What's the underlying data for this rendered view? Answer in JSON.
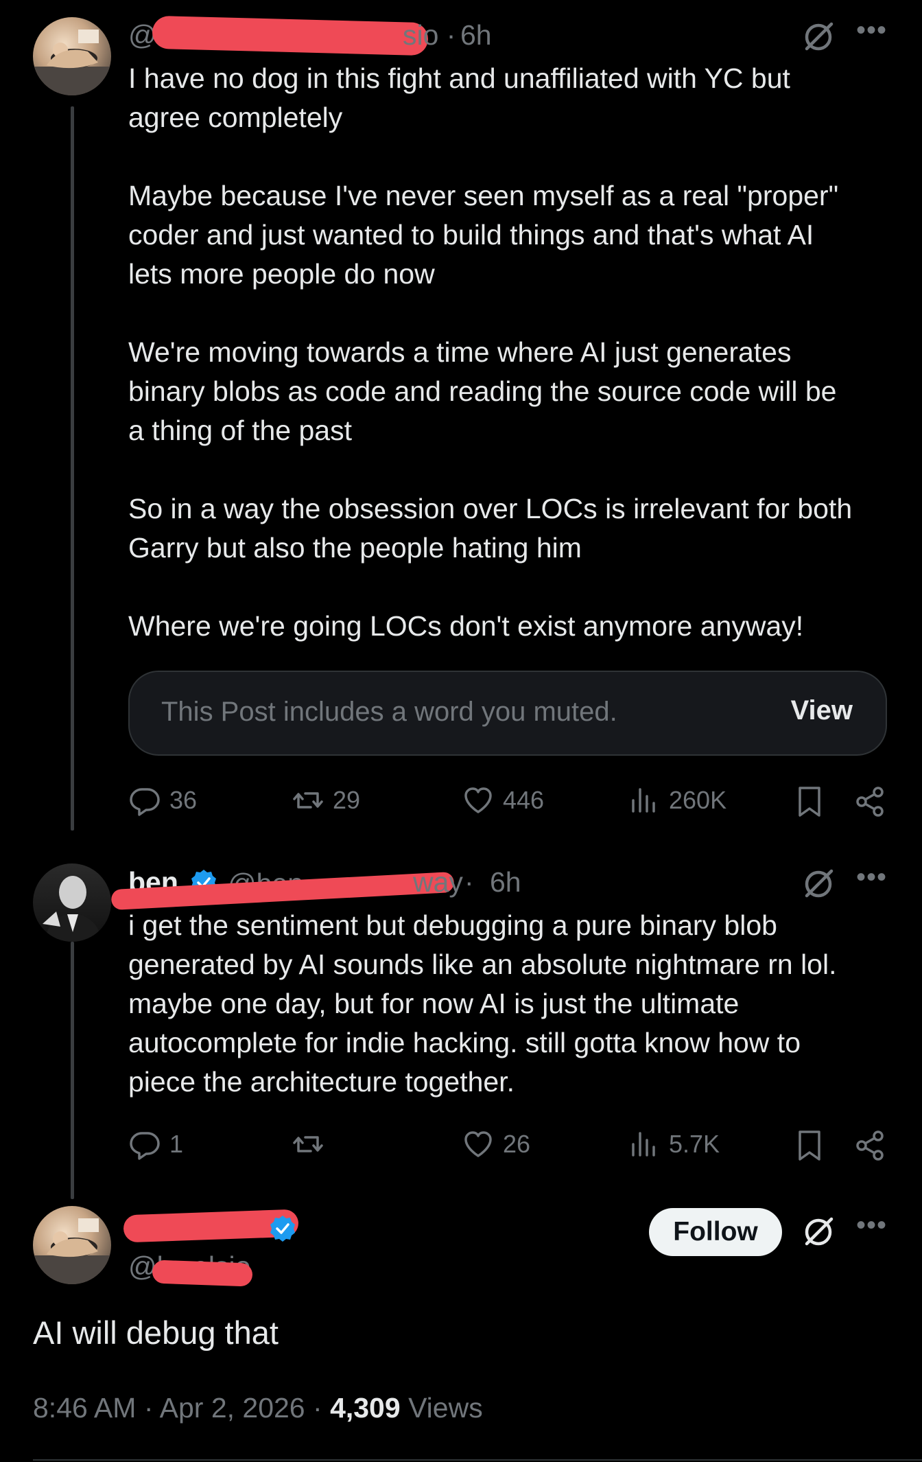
{
  "posts": [
    {
      "handle_prefix": "@",
      "time_prefix": "sio · ",
      "time": "6h",
      "text": "I have no dog in this fight and unaffiliated with YC but\nagree completely\n\nMaybe because I've never seen myself as a real \"proper\"\ncoder and just wanted to build things and that's what AI\nlets more people do now\n\nWe're moving towards a time where AI just generates\nbinary blobs as code and reading the source code will be\na thing of the past\n\nSo in a way the obsession over LOCs is irrelevant for both\nGarry but also the people hating him\n\nWhere we're going LOCs don't exist anymore anyway!",
      "muted_notice": "This Post includes a word you muted.",
      "view_label": "View",
      "replies": "36",
      "reposts": "29",
      "likes": "446",
      "views": "260K"
    },
    {
      "name_fragment": "ben",
      "handle_fragment": "@ben",
      "handle_tail": "way",
      "time_prefix": " · ",
      "time": "6h",
      "text": "i get the sentiment but debugging a pure binary blob\ngenerated by AI sounds like an absolute nightmare rn lol.\nmaybe one day, but for now AI is just the ultimate\nautocomplete for indie hacking. still gotta know how to\npiece the architecture together.",
      "replies": "1",
      "reposts": "",
      "likes": "26",
      "views": "5.7K"
    }
  ],
  "main_post": {
    "handle": "@levelsio",
    "follow_label": "Follow",
    "text": "AI will debug that",
    "time": "8:46 AM",
    "date": "Apr 2, 2026",
    "sep": " · ",
    "views_count": "4,309",
    "views_label": "Views"
  },
  "colors": {
    "background": "#000000",
    "text": "#e7e9ea",
    "muted": "#71767b",
    "verified": "#1d9bf0",
    "redaction": "#ef4a56"
  },
  "icons": [
    "grok-icon",
    "more-icon",
    "reply-icon",
    "repost-icon",
    "like-icon",
    "views-icon",
    "bookmark-icon",
    "share-icon",
    "verified-badge-icon"
  ]
}
